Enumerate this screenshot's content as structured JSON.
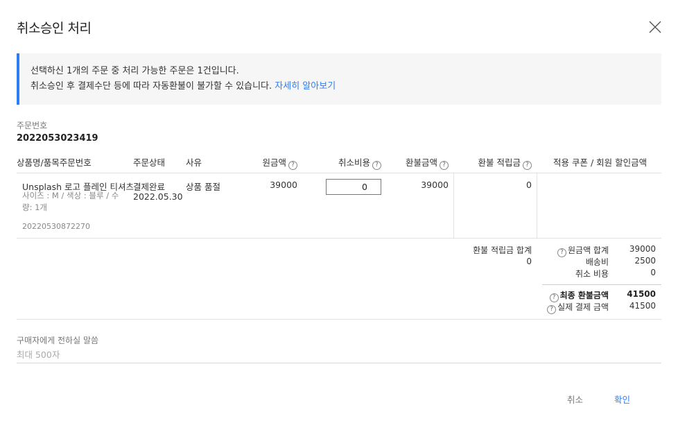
{
  "dialog": {
    "title": "취소승인 처리",
    "close_icon": "close-icon"
  },
  "notice": {
    "line1": "선택하신 1개의 주문 중 처리 가능한 주문은 1건입니다.",
    "line2": "취소승인 후 결제수단 등에 따라 자동환불이 불가할 수 있습니다.",
    "link": "자세히 알아보기",
    "accent_color": "#2f7df6"
  },
  "order": {
    "label": "주문번호",
    "number": "2022053023419"
  },
  "table": {
    "headers": {
      "product": "상품명/품목주문번호",
      "status": "주문상태",
      "reason": "사유",
      "original": "원금액",
      "cancel_fee": "취소비용",
      "refund": "환불금액",
      "refund_points": "환불 적립금",
      "coupon": "적용 쿠폰 / 회원 할인금액"
    },
    "row": {
      "product_name": "Unsplash 로고 플레인 티셔츠",
      "option_line1": "사이즈 : M / 색상 : 블루 / 수",
      "option_line2": "량: 1개",
      "item_order_no": "20220530872270",
      "status": "결제완료",
      "status_date": "2022.05.30",
      "reason": "상품 품절",
      "original": "39000",
      "cancel_fee_value": "0",
      "refund": "39000",
      "refund_points": "0"
    }
  },
  "summary": {
    "points_label": "환불 적립금 합계",
    "points_value": "0",
    "original_total_label": "원금액 합계",
    "original_total_value": "39000",
    "shipping_label": "배송비",
    "shipping_value": "2500",
    "cancel_fee_label": "취소 비용",
    "cancel_fee_value": "0",
    "final_refund_label": "최종 환불금액",
    "final_refund_value": "41500",
    "actual_payment_label": "실제 결제 금액",
    "actual_payment_value": "41500"
  },
  "message": {
    "label": "구매자에게 전하실 말씀",
    "placeholder": "최대 500자"
  },
  "footer": {
    "cancel": "취소",
    "confirm": "확인"
  }
}
